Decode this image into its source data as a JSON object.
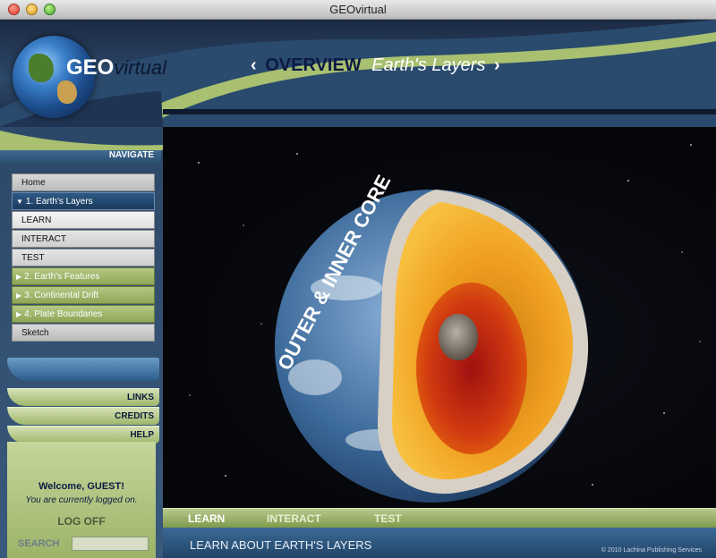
{
  "window": {
    "title": "GEOvirtual"
  },
  "logo": {
    "geo": "GEO",
    "virtual": "virtual"
  },
  "header": {
    "section": "OVERVIEW",
    "topic": "Earth's Layers",
    "prev": "‹",
    "next": "›"
  },
  "sidebar": {
    "navigate_label": "NAVIGATE",
    "items": [
      {
        "label": "Home"
      },
      {
        "label": "1. Earth's Layers"
      },
      {
        "label": "LEARN"
      },
      {
        "label": "INTERACT"
      },
      {
        "label": "TEST"
      },
      {
        "label": "2. Earth's Features"
      },
      {
        "label": "3. Continental Drift"
      },
      {
        "label": "4. Plate Boundaries"
      },
      {
        "label": "Sketch"
      }
    ],
    "links": [
      "LINKS",
      "CREDITS",
      "HELP"
    ],
    "welcome": "Welcome, GUEST!",
    "logged_in": "You are currently logged on.",
    "logoff": "LOG OFF",
    "search_label": "SEARCH",
    "search_value": ""
  },
  "main": {
    "image_caption": "OUTER & INNER CORE",
    "tabs": [
      "LEARN",
      "INTERACT",
      "TEST"
    ],
    "description": "LEARN ABOUT EARTH'S LAYERS",
    "copyright": "© 2010 Lachina Publishing Services"
  },
  "colors": {
    "navy": "#0d1a44",
    "green": "#9eb66a",
    "blue": "#2c5c8a",
    "core_orange": "#f0a020"
  },
  "icons": {
    "triangle_down": "▼",
    "triangle_right": "▶"
  }
}
